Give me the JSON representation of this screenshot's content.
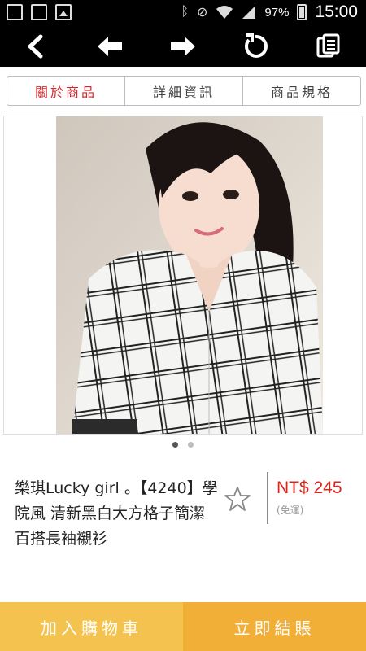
{
  "status_bar": {
    "battery_percent": "97%",
    "time": "15:00",
    "icons": [
      "calendar-icon",
      "sim-card-off-icon",
      "image-icon",
      "bluetooth-icon",
      "mute-icon",
      "wifi-icon",
      "signal-icon",
      "battery-icon"
    ]
  },
  "toolbar": {
    "buttons": [
      "back-chevron-icon",
      "arrow-left-icon",
      "arrow-right-icon",
      "reload-icon",
      "copy-icon"
    ]
  },
  "tabs": [
    {
      "label": "關於商品",
      "active": true
    },
    {
      "label": "詳細資訊",
      "active": false
    },
    {
      "label": "商品規格",
      "active": false
    }
  ],
  "carousel": {
    "count": 2,
    "active_index": 0
  },
  "product": {
    "title": "樂琪Lucky girl 。【4240】學院風 清新黑白大方格子簡潔百搭長袖襯衫",
    "price": "NT$ 245",
    "shipping": "(免運)"
  },
  "actions": {
    "add_to_cart": "加入購物車",
    "checkout": "立即結賬"
  },
  "colors": {
    "accent_red": "#d8232a",
    "price_red": "#e0241b",
    "cart_yellow": "#f4c24e",
    "checkout_orange": "#f1af37"
  }
}
